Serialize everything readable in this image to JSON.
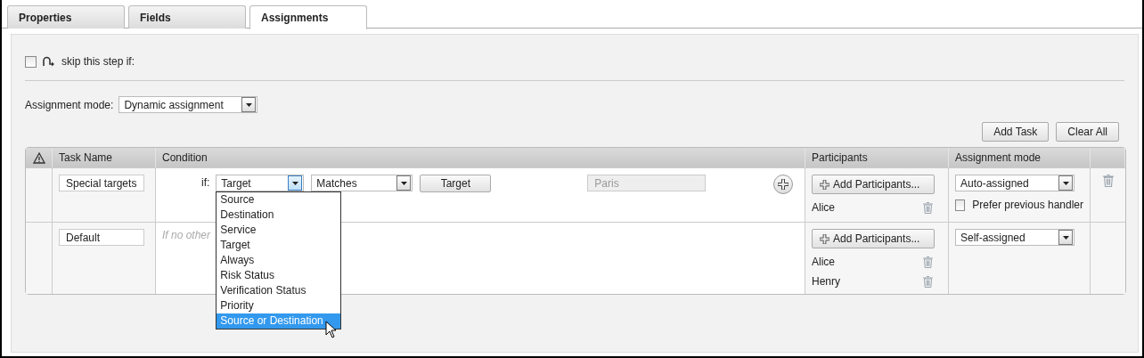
{
  "tabs": [
    {
      "label": "Properties",
      "selected": false
    },
    {
      "label": "Fields",
      "selected": false
    },
    {
      "label": "Assignments",
      "selected": true
    }
  ],
  "skip": {
    "label": "skip this step if:",
    "checked": false
  },
  "assignment_mode": {
    "label": "Assignment mode:",
    "value": "Dynamic assignment"
  },
  "buttons": [
    "Add Task",
    "Clear All"
  ],
  "table": {
    "columns": [
      "Task Name",
      "Condition",
      "Participants",
      "Assignment mode"
    ],
    "rows": [
      {
        "task_name": "Special targets",
        "condition": {
          "kind": "rule",
          "prefix": "if:",
          "field": "Target",
          "operator": "Matches",
          "value_button": "Target",
          "value_field": "Paris",
          "open_list": [
            {
              "label": "Source",
              "selected": false
            },
            {
              "label": "Destination",
              "selected": false
            },
            {
              "label": "Service",
              "selected": false
            },
            {
              "label": "Target",
              "selected": false
            },
            {
              "label": "Always",
              "selected": false
            },
            {
              "label": "Risk Status",
              "selected": false
            },
            {
              "label": "Verification Status",
              "selected": false
            },
            {
              "label": "Priority",
              "selected": false
            },
            {
              "label": "Source or Destination",
              "selected": true
            }
          ]
        },
        "participants_button": "Add Participants...",
        "participants": [
          "Alice"
        ],
        "mode": "Auto-assigned",
        "prefer_previous": {
          "label": "Prefer previous handler",
          "checked": false
        },
        "deletable": true
      },
      {
        "task_name": "Default",
        "condition": {
          "kind": "fallback",
          "text": "If no other"
        },
        "participants_button": "Add Participants...",
        "participants": [
          "Alice",
          "Henry"
        ],
        "mode": "Self-assigned",
        "deletable": false
      }
    ]
  }
}
